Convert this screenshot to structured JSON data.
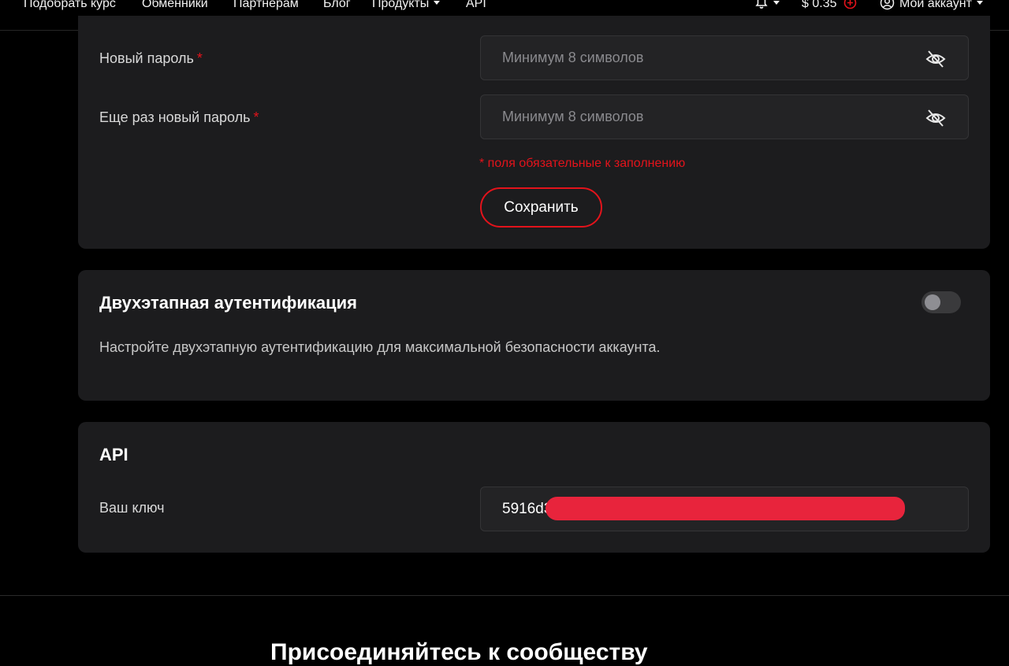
{
  "nav": {
    "items": [
      "Подобрать курс",
      "Обменники",
      "Партнерам",
      "Блог",
      "Продукты",
      "API"
    ],
    "balance": "$ 0.35",
    "account": "Мой аккаунт"
  },
  "password": {
    "new_label": "Новый пароль",
    "repeat_label": "Еще раз новый пароль",
    "required_mark": "*",
    "placeholder": "Минимум 8 символов",
    "required_note": "* поля обязательные к заполнению",
    "save_label": "Сохранить"
  },
  "twofa": {
    "title": "Двухэтапная аутентификация",
    "description": "Настройте двухэтапную аутентификацию для максимальной безопасности аккаунта.",
    "enabled": false
  },
  "api": {
    "title": "API",
    "key_label": "Ваш ключ",
    "key_visible": "5916d3"
  },
  "footer": {
    "title": "Присоединяйтесь к сообществу"
  },
  "colors": {
    "accent": "#e3131b",
    "card": "#1c1c1e",
    "background": "#000000"
  }
}
